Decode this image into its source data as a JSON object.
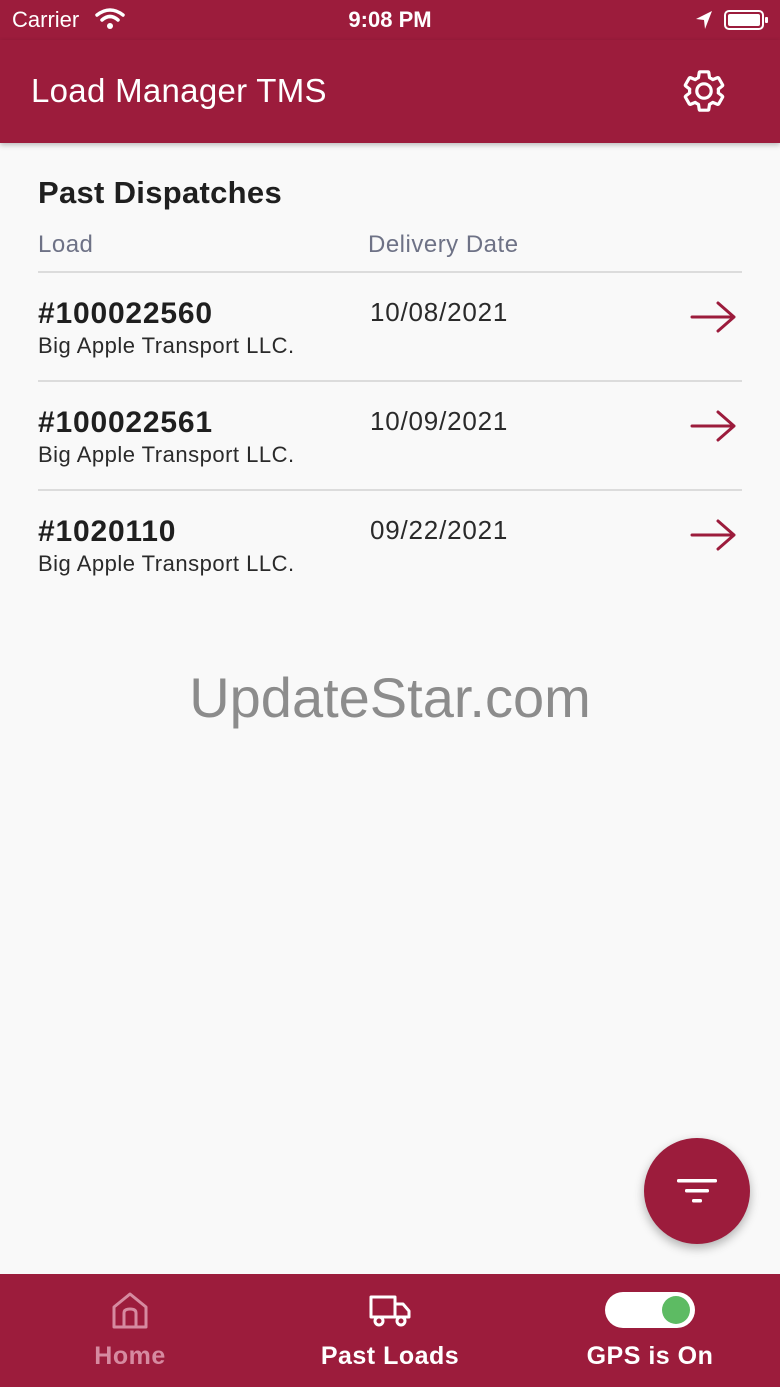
{
  "status_bar": {
    "carrier": "Carrier",
    "time": "9:08 PM"
  },
  "app_bar": {
    "title": "Load Manager TMS",
    "settings_icon": "gear-icon"
  },
  "section": {
    "title": "Past Dispatches",
    "columns": {
      "load": "Load",
      "delivery_date": "Delivery Date"
    }
  },
  "dispatches": [
    {
      "load_id": "#100022560",
      "company": "Big Apple Transport LLC.",
      "delivery_date": "10/08/2021"
    },
    {
      "load_id": "#100022561",
      "company": "Big Apple Transport LLC.",
      "delivery_date": "10/09/2021"
    },
    {
      "load_id": "#1020110",
      "company": "Big Apple Transport LLC.",
      "delivery_date": "09/22/2021"
    }
  ],
  "watermark": "UpdateStar.com",
  "bottom_nav": {
    "home": "Home",
    "past_loads": "Past Loads",
    "gps": "GPS is On"
  },
  "gps_toggle_on": true,
  "colors": {
    "brand": "#9c1c3c",
    "toggle_on": "#5dbb63"
  }
}
